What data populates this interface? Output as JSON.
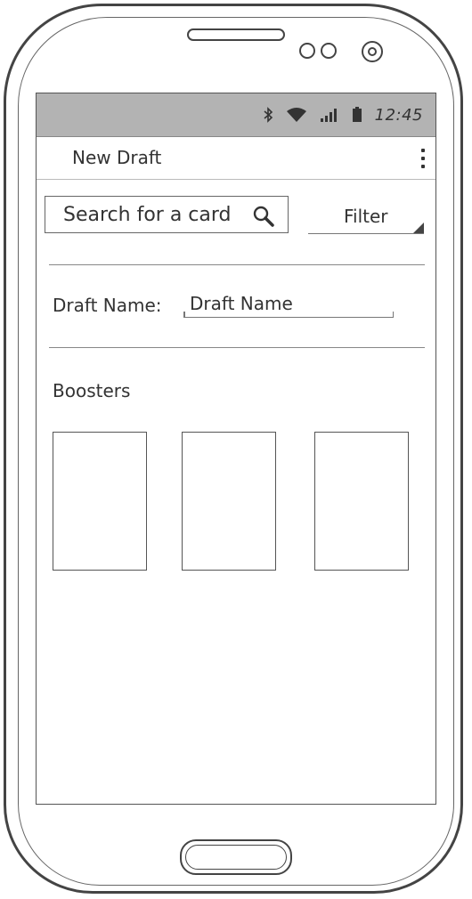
{
  "statusbar": {
    "icons": [
      "bluetooth-icon",
      "wifi-icon",
      "signal-icon",
      "battery-icon"
    ],
    "time": "12:45"
  },
  "appbar": {
    "title": "New Draft",
    "menu_icon": "overflow-menu-icon"
  },
  "search": {
    "placeholder": "Search for a card",
    "icon": "search-icon"
  },
  "filter": {
    "label": "Filter"
  },
  "draft": {
    "label": "Draft Name:",
    "value": "Draft Name"
  },
  "boosters": {
    "label": "Boosters",
    "slots": 3
  },
  "colors": {
    "statusbar_bg": "#b3b3b3",
    "ink": "#333333",
    "screen_bg": "#ffffff"
  }
}
